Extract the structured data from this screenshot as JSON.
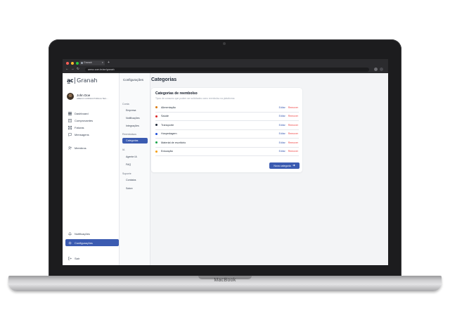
{
  "device": {
    "label": "MacBook"
  },
  "browser": {
    "tab_title": "Granah",
    "tab_close": "×",
    "tab_add": "+",
    "url": "arenz.com.br/arr/granah",
    "back": "←",
    "forward": "→",
    "reload": "↻"
  },
  "sidebar": {
    "logo_mark": "a̲c",
    "logo_text": "Granah",
    "user": {
      "name": "John Doe",
      "company": "ARECO CONSULTORIA E TEC..."
    },
    "items": [
      {
        "label": "Dashboard",
        "icon": "dashboard-icon"
      },
      {
        "label": "Comprovantes",
        "icon": "receipt-icon"
      },
      {
        "label": "Faturas",
        "icon": "invoice-icon"
      },
      {
        "label": "Mensagens",
        "icon": "message-icon"
      },
      {
        "label": "Membros",
        "icon": "users-icon"
      }
    ],
    "bottom": [
      {
        "label": "Notificações",
        "icon": "bell-icon"
      },
      {
        "label": "Configurações",
        "icon": "gear-icon",
        "active": true
      }
    ],
    "logout": {
      "label": "Sair",
      "icon": "logout-icon"
    }
  },
  "config_menu": {
    "title": "Configurações",
    "groups": [
      {
        "label": "Conta",
        "items": [
          "Empresa",
          "Notificações",
          "Integrações"
        ]
      },
      {
        "label": "Reembolsos",
        "items": [
          "Categorias"
        ]
      },
      {
        "label": "IA",
        "items": [
          "Agente IA",
          "FAQ"
        ]
      },
      {
        "label": "Suporte",
        "items": [
          "Contatos",
          "Sobre"
        ]
      }
    ],
    "active_item": "Categorias"
  },
  "main": {
    "title": "Categorias",
    "card": {
      "title": "Categorias de reembolso",
      "subtitle": "Tipos de consumo que podem ser solicitados como reembolso na plataforma",
      "categories": [
        {
          "name": "Alimentação",
          "color": "#d97706"
        },
        {
          "name": "Saúde",
          "color": "#dc2626"
        },
        {
          "name": "Transporte",
          "color": "#1f2937"
        },
        {
          "name": "Hospedagem",
          "color": "#1d4ed8"
        },
        {
          "name": "Material de escritório",
          "color": "#16a34a"
        },
        {
          "name": "Educação",
          "color": "#f59e0b"
        }
      ],
      "edit_label": "Editar",
      "remove_label": "Remover",
      "new_button": "Nova categoria"
    }
  },
  "colors": {
    "accent": "#3b5bb1",
    "danger": "#ef4444"
  }
}
